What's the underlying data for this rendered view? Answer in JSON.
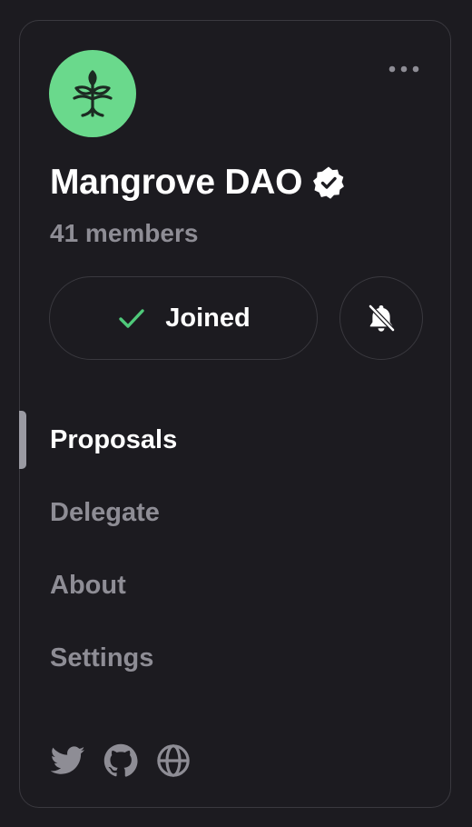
{
  "community": {
    "name": "Mangrove DAO",
    "members": "41 members",
    "avatar_icon": "mangrove-tree-icon",
    "avatar_color": "#6ad98c",
    "verified_icon": "verified-badge-icon"
  },
  "actions": {
    "joined_label": "Joined",
    "joined_icon": "check-icon",
    "check_color": "#4fc97a",
    "notifications_icon": "bell-off-icon",
    "more_icon": "more-horizontal-icon"
  },
  "nav": {
    "active_index": 0,
    "items": [
      {
        "label": "Proposals"
      },
      {
        "label": "Delegate"
      },
      {
        "label": "About"
      },
      {
        "label": "Settings"
      }
    ]
  },
  "social": [
    {
      "icon": "twitter-icon"
    },
    {
      "icon": "github-icon"
    },
    {
      "icon": "globe-icon"
    }
  ],
  "colors": {
    "background": "#1c1b20",
    "border": "#3a393f",
    "text_primary": "#ffffff",
    "text_secondary": "#8e8d95"
  }
}
